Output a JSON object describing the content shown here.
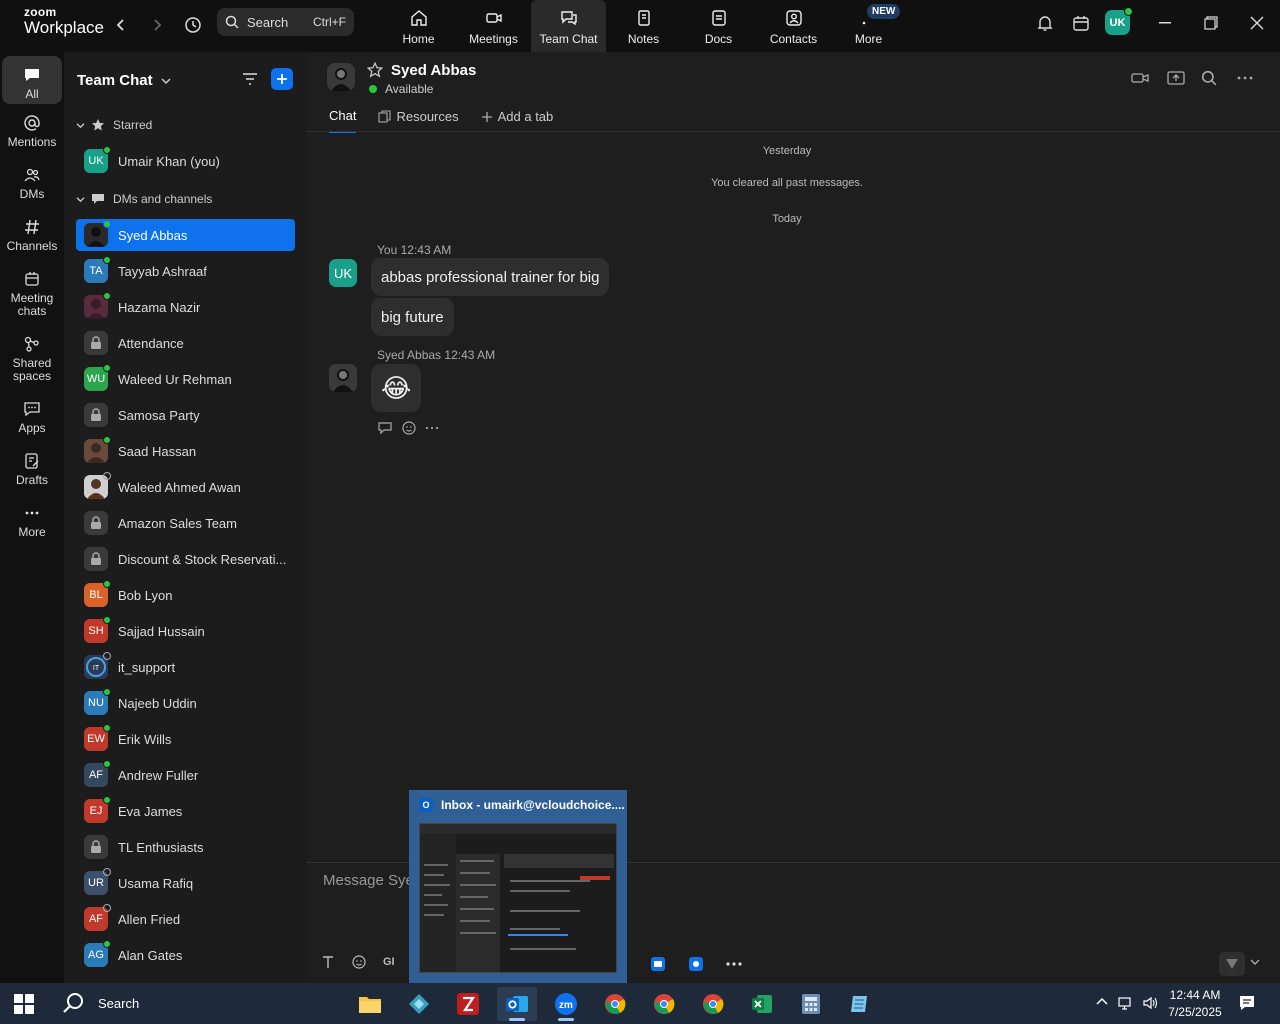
{
  "app": {
    "brand_top": "zoom",
    "brand_bottom": "Workplace"
  },
  "search": {
    "label": "Search",
    "shortcut": "Ctrl+F"
  },
  "nav_tabs": [
    {
      "label": "Home",
      "icon": "home-icon"
    },
    {
      "label": "Meetings",
      "icon": "video-icon"
    },
    {
      "label": "Team Chat",
      "icon": "chat-icon",
      "active": true
    },
    {
      "label": "Notes",
      "icon": "notes-icon"
    },
    {
      "label": "Docs",
      "icon": "docs-icon"
    },
    {
      "label": "Contacts",
      "icon": "contacts-icon"
    },
    {
      "label": "More",
      "icon": "more-icon",
      "badge": "NEW"
    }
  ],
  "user": {
    "initials": "UK"
  },
  "rail": [
    {
      "label": "All",
      "icon": "chat-bubble-icon",
      "active": true
    },
    {
      "label": "Mentions",
      "icon": "at-icon"
    },
    {
      "label": "DMs",
      "icon": "people-icon"
    },
    {
      "label": "Channels",
      "icon": "hash-icon"
    },
    {
      "label": "Meeting chats",
      "line1": "Meeting",
      "line2": "chats",
      "icon": "calendar-icon"
    },
    {
      "label": "Shared spaces",
      "line1": "Shared",
      "line2": "spaces",
      "icon": "share-icon"
    },
    {
      "label": "Apps",
      "icon": "apps-icon"
    },
    {
      "label": "Drafts",
      "icon": "drafts-icon"
    },
    {
      "label": "More",
      "icon": "ellipsis-icon"
    }
  ],
  "sidebar": {
    "title": "Team Chat",
    "starred_label": "Starred",
    "dms_label": "DMs and channels",
    "starred": [
      {
        "name": "Umair Khan (you)",
        "initials": "UK",
        "color": "#1aa088",
        "status": "on"
      }
    ],
    "contacts": [
      {
        "name": "Syed Abbas",
        "type": "photo",
        "status": "on",
        "selected": true
      },
      {
        "name": "Tayyab Ashraaf",
        "initials": "TA",
        "color": "#2b7bb9",
        "status": "on"
      },
      {
        "name": "Hazama Nazir",
        "type": "photo2",
        "status": "on"
      },
      {
        "name": "Attendance",
        "type": "lock"
      },
      {
        "name": "Waleed Ur Rehman",
        "initials": "WU",
        "color": "#2da44e",
        "status": "on"
      },
      {
        "name": "Samosa Party",
        "type": "lock"
      },
      {
        "name": "Saad Hassan",
        "type": "photo3",
        "status": "on"
      },
      {
        "name": "Waleed Ahmed Awan",
        "type": "photo4",
        "status": "off"
      },
      {
        "name": "Amazon Sales Team",
        "type": "lock"
      },
      {
        "name": "Discount & Stock Reservati...",
        "type": "lock"
      },
      {
        "name": "Bob Lyon",
        "initials": "BL",
        "color": "#d9622b",
        "status": "on"
      },
      {
        "name": "Sajjad Hussain",
        "initials": "SH",
        "color": "#c0392b",
        "status": "on"
      },
      {
        "name": "it_support",
        "type": "ring",
        "status": "offgreen"
      },
      {
        "name": "Najeeb Uddin",
        "initials": "NU",
        "color": "#2b7bb9",
        "status": "on"
      },
      {
        "name": "Erik Wills",
        "initials": "EW",
        "color": "#c0392b",
        "status": "on"
      },
      {
        "name": "Andrew Fuller",
        "initials": "AF",
        "color": "#34495e",
        "status": "on"
      },
      {
        "name": "Eva James",
        "initials": "EJ",
        "color": "#c0392b",
        "status": "on"
      },
      {
        "name": "TL Enthusiasts",
        "type": "lock"
      },
      {
        "name": "Usama Rafiq",
        "initials": "UR",
        "color": "#3d4f6a",
        "status": "off"
      },
      {
        "name": "Allen Fried",
        "initials": "AF",
        "color": "#c0392b",
        "status": "off"
      },
      {
        "name": "Alan Gates",
        "initials": "AG",
        "color": "#2b7bb9",
        "status": "on"
      }
    ]
  },
  "chat": {
    "name": "Syed Abbas",
    "status": "Available",
    "tabs": [
      "Chat",
      "Resources",
      "Add a tab"
    ],
    "sys_yesterday": "Yesterday",
    "sys_cleared": "You cleared all past messages.",
    "sys_today": "Today",
    "msg1_author": "You",
    "msg1_time": "12:43 AM",
    "msg1_initials": "UK",
    "msg1_text1": "abbas professional trainer for big",
    "msg1_text2": "big future",
    "msg2_author": "Syed Abbas",
    "msg2_time": "12:43 AM",
    "msg2_emoji": "😂",
    "composer_placeholder": "Message Sye",
    "toolbar_gif": "GI"
  },
  "preview": {
    "title": "Inbox - umairk@vcloudchoice...."
  },
  "taskbar": {
    "search": "Search",
    "time": "12:44 AM",
    "date": "7/25/2025"
  }
}
